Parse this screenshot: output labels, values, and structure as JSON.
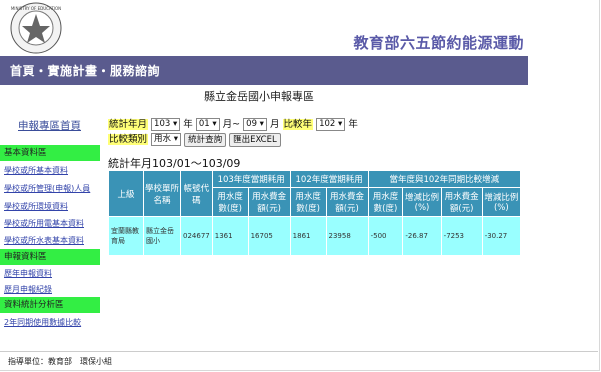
{
  "header": {
    "site_title": "教育部六五節約能源運動",
    "logo_text": "MINISTRY OF EDUCATION"
  },
  "nav": {
    "text": "首頁・實施計畫・服務諮詢"
  },
  "page": {
    "heading": "縣立金岳國小申報專區"
  },
  "sidebar": {
    "home": "申報專區首頁",
    "sections": [
      {
        "title": "基本資料區",
        "links": [
          "學校或所基本資料",
          "學校或所管理(申報)人員",
          "學校或所環境資料",
          "學校或所用電基本資料",
          "學校或所水表基本資料"
        ]
      },
      {
        "title": "申報資料區",
        "links": [
          "歷年申報資料",
          "歷月申報紀錄"
        ]
      },
      {
        "title": "資料統計分析區",
        "links": [
          "2年同期使用數據比較"
        ]
      }
    ]
  },
  "filters": {
    "period_label": "統計年月",
    "year_start": "103",
    "year_unit": "年",
    "month_start": "01",
    "month_to": "月~",
    "month_end": "09",
    "month_unit": "月",
    "compare_label": "比較年",
    "compare_year": "102",
    "compare_unit": "年",
    "category_label": "比較類別",
    "category_value": "用水",
    "query_button": "統計查詢",
    "export_button": "匯出EXCEL"
  },
  "stat_period": "統計年月103/01～103/09",
  "table": {
    "h_superior": "上級",
    "h_school": "學校單所名稱",
    "h_account": "帳號代碼",
    "h_group_cur": "103年度當期耗用",
    "h_group_prev": "102年度當期耗用",
    "h_group_cmp": "當年度與102年同期比較增減",
    "sub": [
      "用水度數(度)",
      "用水費金額(元)",
      "用水度數(度)",
      "用水費金額(元)",
      "用水度數(度)",
      "增減比例(%)",
      "用水費金額(元)",
      "增減比例(%)"
    ],
    "rows": [
      {
        "superior": "宜蘭縣教育局",
        "school": "縣立金岳國小",
        "account": "024677",
        "cur_deg": "1361",
        "cur_fee": "16705",
        "prev_deg": "1861",
        "prev_fee": "23958",
        "diff_deg": "-500",
        "diff_deg_pct": "-26.87",
        "diff_fee": "-7253",
        "diff_fee_pct": "-30.27"
      }
    ]
  },
  "footer": {
    "text": "指導單位：教育部　環保小組"
  }
}
